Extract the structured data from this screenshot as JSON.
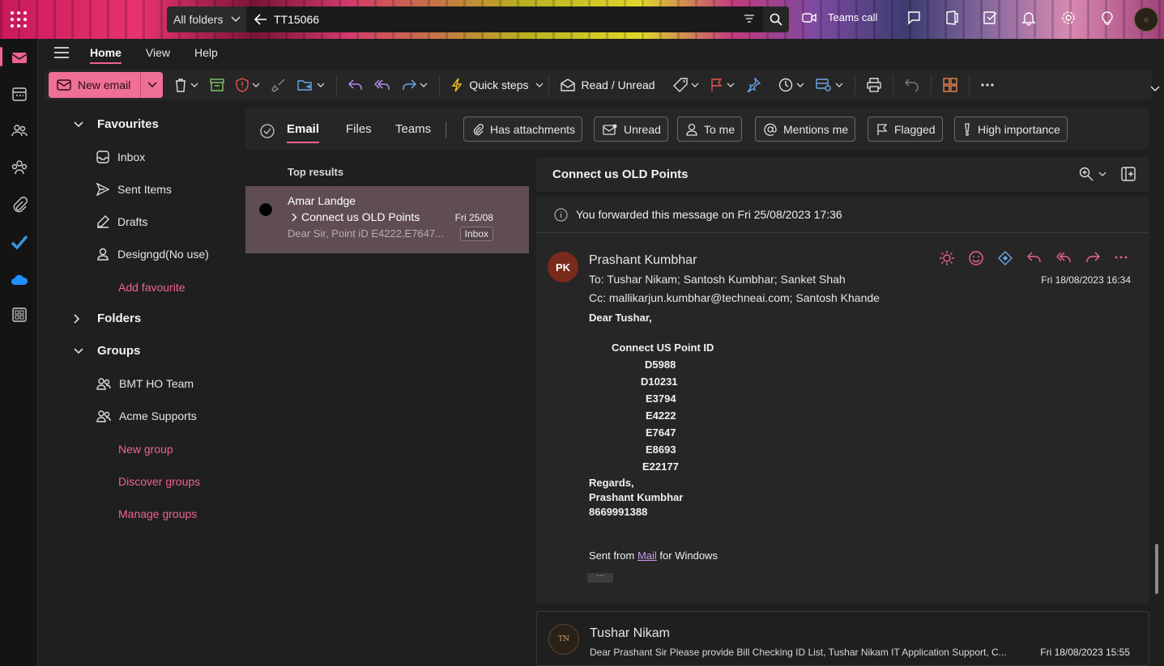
{
  "topbar": {
    "search_scope": "All folders",
    "search_query": "TT15066",
    "teams_call": "Teams call"
  },
  "menu": {
    "tabs": [
      "Home",
      "View",
      "Help"
    ]
  },
  "ribbon": {
    "new_email": "New email",
    "quick_steps": "Quick steps",
    "read_unread": "Read / Unread"
  },
  "nav": {
    "favourites": "Favourites",
    "inbox": "Inbox",
    "sent": "Sent Items",
    "drafts": "Drafts",
    "designgd": "Designgd(No use)",
    "add_favourite": "Add favourite",
    "folders": "Folders",
    "groups": "Groups",
    "group1": "BMT HO Team",
    "group2": "Acme Supports",
    "new_group": "New group",
    "discover_groups": "Discover groups",
    "manage_groups": "Manage groups"
  },
  "filters": {
    "tabs": [
      "Email",
      "Files",
      "Teams"
    ],
    "chips": [
      "Has attachments",
      "Unread",
      "To me",
      "Mentions me",
      "Flagged",
      "High importance"
    ]
  },
  "list": {
    "header": "Top results",
    "item": {
      "from": "Amar Landge",
      "subject": "Connect us OLD Points",
      "date": "Fri 25/08",
      "preview": "Dear Sir, Point iD E4222,E7647...",
      "folder": "Inbox"
    }
  },
  "reader": {
    "subject": "Connect us OLD Points",
    "forward_note": "You forwarded this message on Fri 25/08/2023 17:36",
    "mail1": {
      "initials": "PK",
      "sender": "Prashant Kumbhar",
      "to": "To:  Tushar Nikam;  Santosh Kumbhar;  Sanket Shah",
      "cc": "Cc:  mallikarjun.kumbhar@techneai.com;  Santosh Khande",
      "date": "Fri 18/08/2023 16:34",
      "greeting": "Dear Tushar,",
      "point_header": "Connect US Point ID",
      "points": [
        "D5988",
        "D10231",
        "E3794",
        "E4222",
        "E7647",
        "E8693",
        "E22177"
      ],
      "regards": "Regards,",
      "sig_name": "Prashant Kumbhar",
      "sig_phone": "8669991388",
      "sent_prefix": "Sent from ",
      "sent_link": "Mail",
      "sent_suffix": " for Windows",
      "ellipsis": "···"
    },
    "mail2": {
      "initials": "TN",
      "sender": "Tushar Nikam",
      "snippet": "Dear Prashant Sir Please provide Bill Checking ID List, Tushar Nikam IT Application Support, C...",
      "date": "Fri 18/08/2023 15:55"
    }
  },
  "colors": {
    "accent": "#f06292",
    "selected_row": "#5f4d52"
  }
}
